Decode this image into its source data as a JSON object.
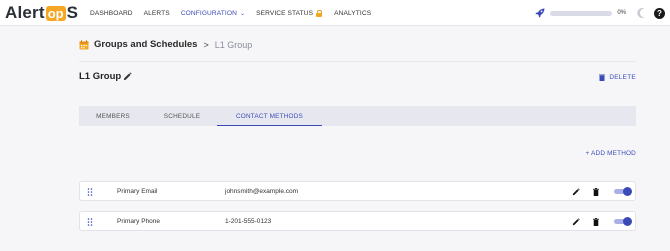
{
  "brand": {
    "logo_left": "Alert",
    "logo_box": "op",
    "logo_right": "S"
  },
  "nav": {
    "items": [
      {
        "label": "DASHBOARD"
      },
      {
        "label": "ALERTS"
      },
      {
        "label": "CONFIGURATION"
      },
      {
        "label": "SERVICE STATUS"
      },
      {
        "label": "ANALYTICS"
      }
    ],
    "active_index": 2,
    "progress_percent": 0,
    "progress_label": "0%"
  },
  "breadcrumb": {
    "parent": "Groups and Schedules",
    "separator": ">",
    "current": "L1 Group"
  },
  "page": {
    "title": "L1 Group",
    "delete_label": "DELETE"
  },
  "tabs": [
    {
      "label": "MEMBERS"
    },
    {
      "label": "SCHEDULE"
    },
    {
      "label": "CONTACT METHODS"
    }
  ],
  "active_tab": 2,
  "add_method_label": "+ ADD METHOD",
  "methods": [
    {
      "name": "Primary Email",
      "value": "johnsmith@example.com",
      "enabled": true
    },
    {
      "name": "Primary Phone",
      "value": "1-201-555-0123",
      "enabled": true
    }
  ],
  "colors": {
    "accent": "#3a4bb8",
    "logo_orange": "#f5a623",
    "lock": "#f0a81c"
  },
  "icons": [
    "rocket-icon",
    "moon-icon",
    "help-icon",
    "calendar-icon",
    "pencil-icon",
    "trash-icon",
    "drag-handle-icon",
    "lock-icon",
    "chevron-down-icon"
  ]
}
